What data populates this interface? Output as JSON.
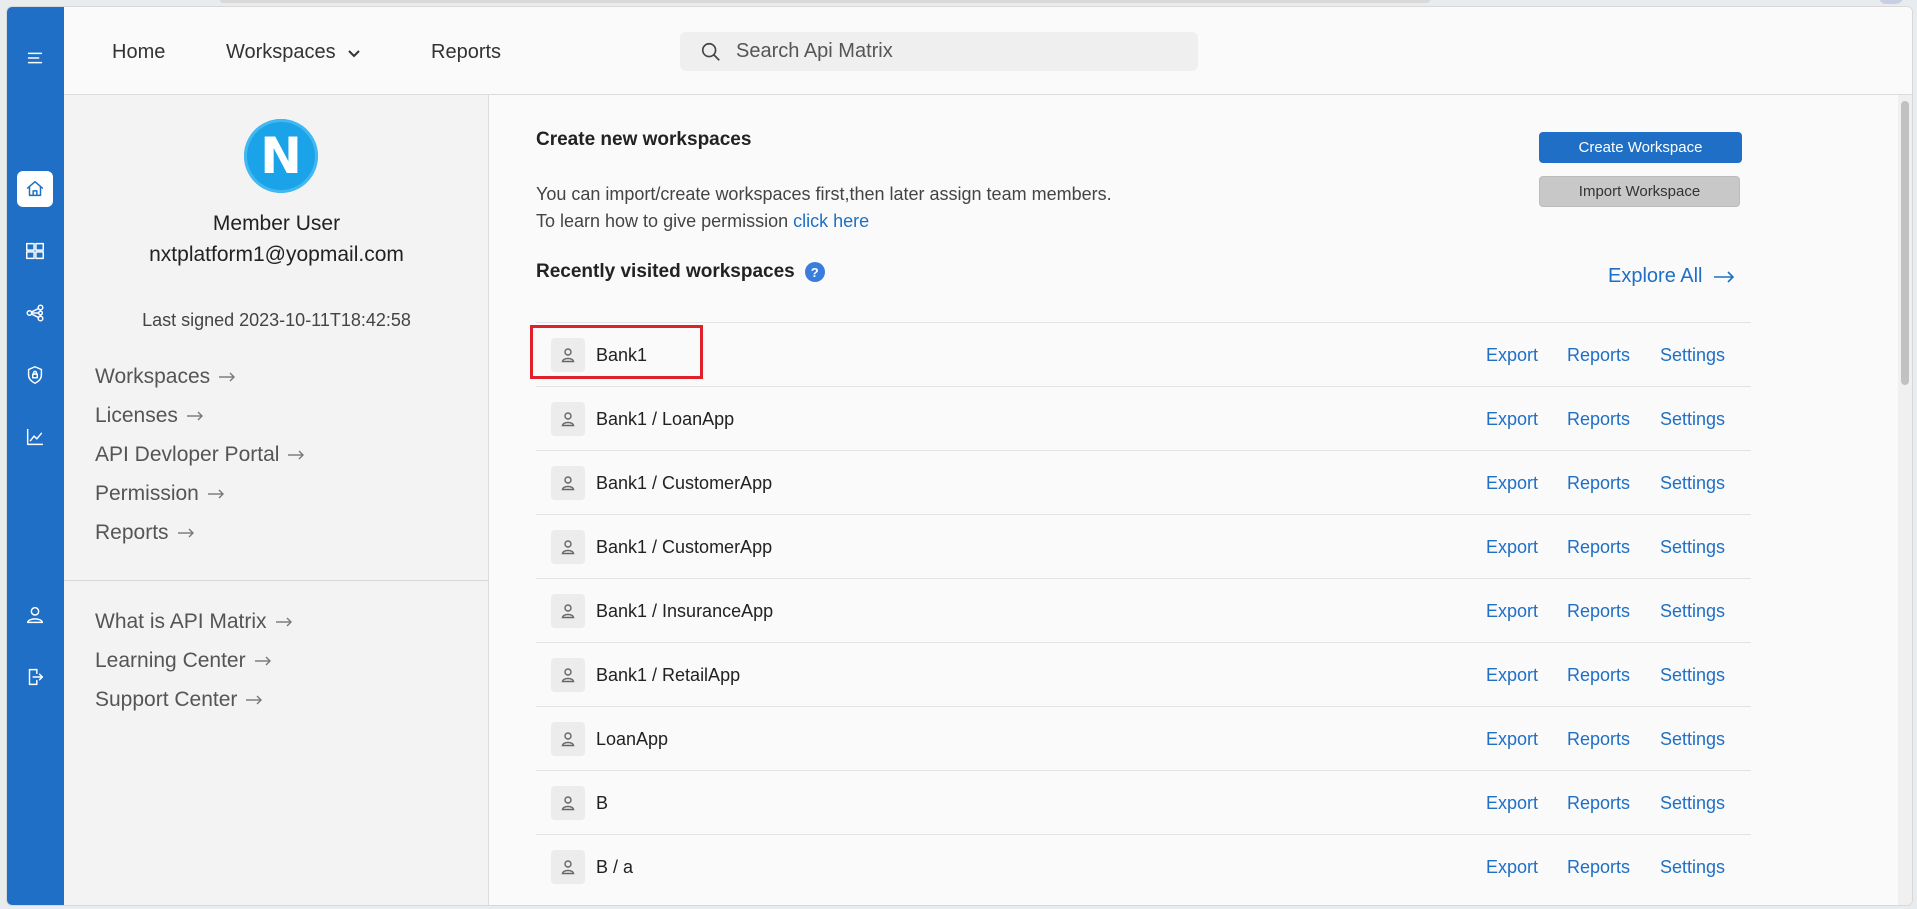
{
  "header": {
    "nav": {
      "home": "Home",
      "workspaces": "Workspaces",
      "reports": "Reports"
    },
    "search": {
      "placeholder": "Search Api Matrix"
    }
  },
  "rail": {
    "icons": [
      "menu-icon",
      "home-icon",
      "dashboard-icon",
      "share-icon",
      "shield-icon",
      "chart-icon",
      "user-icon",
      "logout-icon"
    ]
  },
  "profile": {
    "avatar_letter": "N",
    "name": "Member User",
    "email": "nxtplatform1@yopmail.com",
    "last_signed": "Last signed 2023-10-11T18:42:58",
    "links": [
      "Workspaces",
      "Licenses",
      "API Devloper Portal",
      "Permission",
      "Reports"
    ],
    "help_links": [
      "What is API Matrix",
      "Learning Center",
      "Support Center"
    ]
  },
  "main": {
    "create_title": "Create new workspaces",
    "desc_line1": "You can import/create workspaces first,then later assign team members.",
    "desc_line2": "To learn how to give permission",
    "click_here": "click here",
    "create_button": "Create Workspace",
    "import_button": "Import Workspace",
    "recent_title": "Recently visited workspaces",
    "help_badge": "?",
    "explore_all": "Explore All",
    "actions": {
      "export": "Export",
      "reports": "Reports",
      "settings": "Settings"
    },
    "workspaces": [
      "Bank1",
      "Bank1 / LoanApp",
      "Bank1 / CustomerApp",
      "Bank1 / CustomerApp",
      "Bank1 / InsuranceApp",
      "Bank1 / RetailApp",
      "LoanApp",
      "B",
      "B / a"
    ]
  },
  "colors": {
    "primary": "#1e6fc5",
    "highlight": "#e0202a"
  }
}
